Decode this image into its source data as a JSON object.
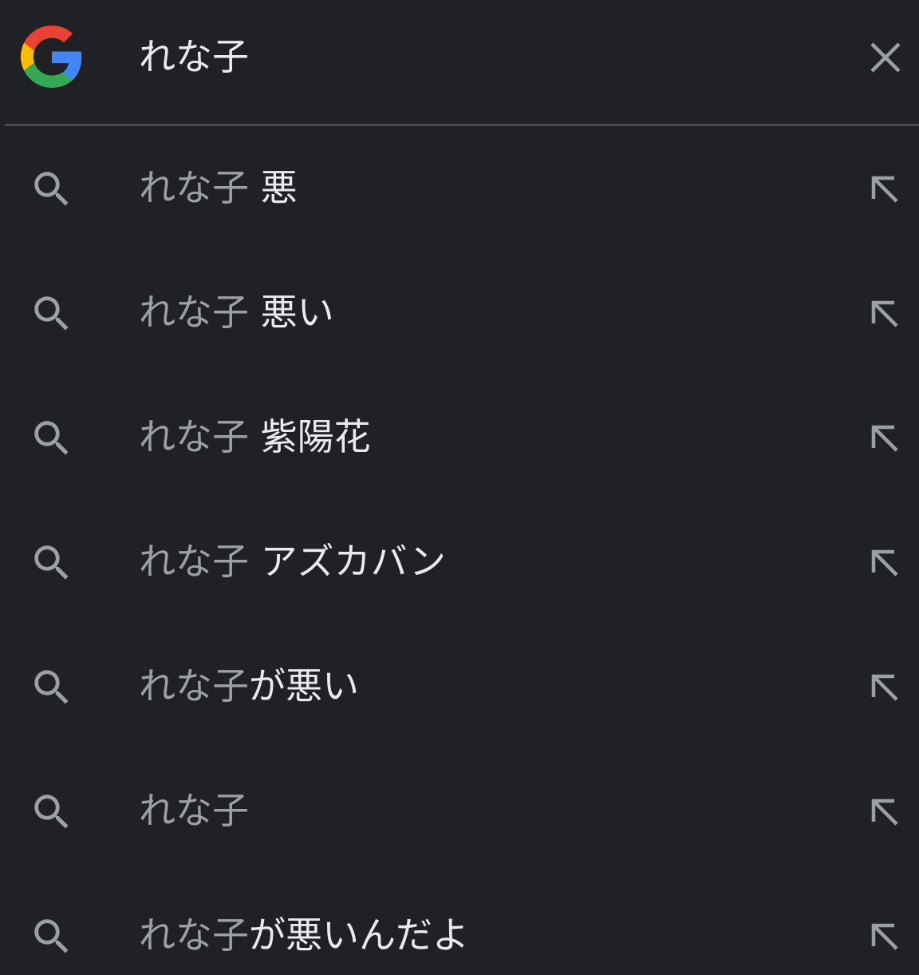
{
  "header": {
    "logo": "google-g-logo",
    "query": "れな子",
    "clear_icon": "close-icon"
  },
  "colors": {
    "background": "#202124",
    "query_text": "#e8eaed",
    "suggestion_prefix": "#9aa0a6",
    "suggestion_suffix": "#e8eaed",
    "icon": "#9aa0a6",
    "divider": "#4a4c50"
  },
  "suggestions": [
    {
      "prefix": "れな子",
      "suffix": " 悪"
    },
    {
      "prefix": "れな子",
      "suffix": " 悪い"
    },
    {
      "prefix": "れな子",
      "suffix": " 紫陽花"
    },
    {
      "prefix": "れな子",
      "suffix": " アズカバン"
    },
    {
      "prefix": "れな子",
      "suffix": "が悪い"
    },
    {
      "prefix": "れな子",
      "suffix": ""
    },
    {
      "prefix": "れな子",
      "suffix": "が悪いんだよ"
    }
  ]
}
